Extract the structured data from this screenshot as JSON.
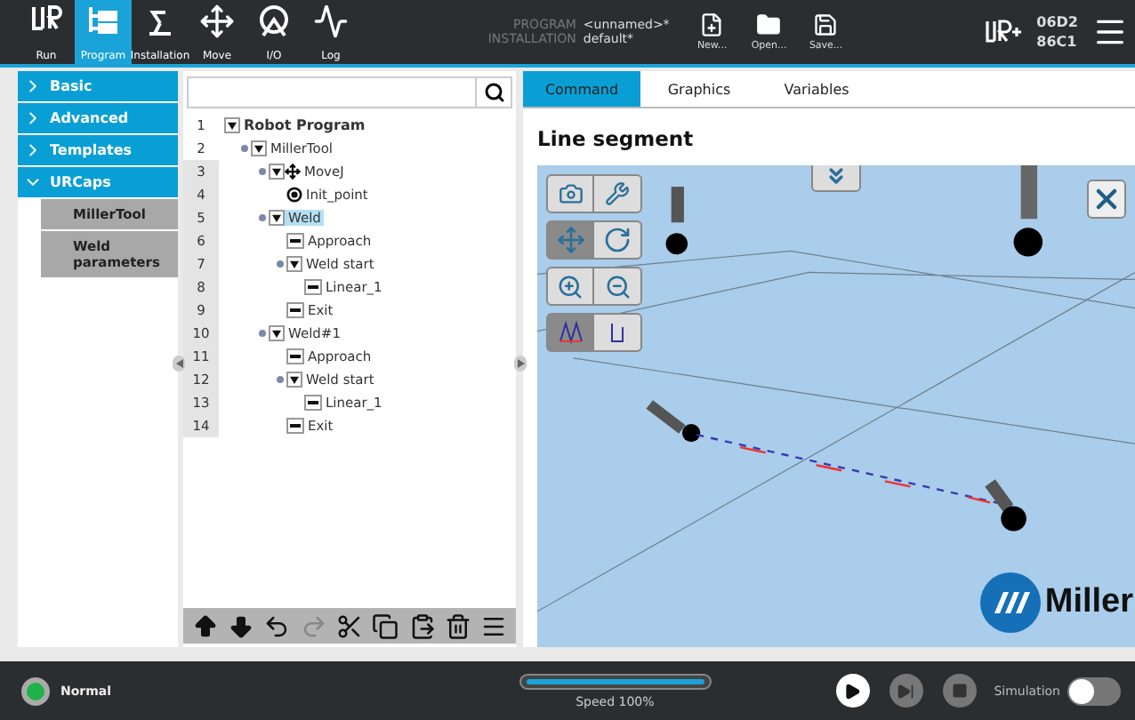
{
  "nav": [
    {
      "label": "Run",
      "kind": "run",
      "selected": false
    },
    {
      "label": "Program",
      "kind": "program",
      "selected": true
    },
    {
      "label": "Installation",
      "kind": "installation",
      "selected": false
    },
    {
      "label": "Move",
      "kind": "move",
      "selected": false
    },
    {
      "label": "I/O",
      "kind": "io",
      "selected": false
    },
    {
      "label": "Log",
      "kind": "log",
      "selected": false
    }
  ],
  "file_info": [
    {
      "key": "PROGRAM",
      "value": "<unnamed>*"
    },
    {
      "key": "INSTALLATION",
      "value": "default*"
    }
  ],
  "file_buttons": [
    {
      "label": "New...",
      "kind": "new"
    },
    {
      "label": "Open...",
      "kind": "open"
    },
    {
      "label": "Save...",
      "kind": "save"
    }
  ],
  "robot_id": [
    "06D2",
    "86C1"
  ],
  "categories": [
    {
      "label": "Basic",
      "expanded": false
    },
    {
      "label": "Advanced",
      "expanded": false
    },
    {
      "label": "Templates",
      "expanded": false
    },
    {
      "label": "URCaps",
      "expanded": true,
      "children": [
        {
          "label": "MillerTool"
        },
        {
          "label": "Weld parameters"
        }
      ]
    }
  ],
  "tree": [
    {
      "number": "1",
      "label": "Robot Program",
      "kind": "program",
      "expanded": true,
      "selected": false,
      "children": [
        {
          "number": "2",
          "label": "MillerTool",
          "kind": "folder",
          "expanded": true,
          "selected": false,
          "children": [
            {
              "number": "3",
              "label": "MoveJ",
              "kind": "move",
              "expanded": true,
              "selected": false,
              "children": [
                {
                  "number": "4",
                  "label": "Init_point",
                  "kind": "waypoint",
                  "selected": false
                }
              ]
            },
            {
              "number": "5",
              "label": "Weld",
              "kind": "folder",
              "expanded": true,
              "selected": true,
              "children": [
                {
                  "number": "6",
                  "label": "Approach",
                  "kind": "line",
                  "selected": false
                },
                {
                  "number": "7",
                  "label": "Weld start",
                  "kind": "folder",
                  "expanded": true,
                  "selected": false,
                  "children": [
                    {
                      "number": "8",
                      "label": "Linear_1",
                      "kind": "line",
                      "selected": false
                    }
                  ]
                },
                {
                  "number": "9",
                  "label": "Exit",
                  "kind": "line",
                  "selected": false
                }
              ]
            },
            {
              "number": "10",
              "label": "Weld#1",
              "kind": "folder",
              "expanded": true,
              "selected": false,
              "children": [
                {
                  "number": "11",
                  "label": "Approach",
                  "kind": "line",
                  "selected": false
                },
                {
                  "number": "12",
                  "label": "Weld start",
                  "kind": "folder",
                  "expanded": true,
                  "selected": false,
                  "children": [
                    {
                      "number": "13",
                      "label": "Linear_1",
                      "kind": "line",
                      "selected": false
                    }
                  ]
                },
                {
                  "number": "14",
                  "label": "Exit",
                  "kind": "line",
                  "selected": false
                }
              ]
            }
          ]
        }
      ]
    }
  ],
  "tools": [
    {
      "kind": "up",
      "disabled": false
    },
    {
      "kind": "down",
      "disabled": false
    },
    {
      "kind": "undo",
      "disabled": false
    },
    {
      "kind": "redo",
      "disabled": true
    },
    {
      "kind": "cut",
      "disabled": false
    },
    {
      "kind": "copy",
      "disabled": false
    },
    {
      "kind": "paste",
      "disabled": false
    },
    {
      "kind": "delete",
      "disabled": false
    },
    {
      "kind": "suppress",
      "disabled": false
    }
  ],
  "tabs": [
    {
      "label": "Command",
      "selected": true
    },
    {
      "label": "Graphics",
      "selected": false
    },
    {
      "label": "Variables",
      "selected": false
    }
  ],
  "command_title": "Line segment",
  "view_tools": [
    {
      "kind": "view-camera",
      "selected": false
    },
    {
      "kind": "view-tool",
      "selected": false
    },
    {
      "kind": "pan",
      "selected": true
    },
    {
      "kind": "rotate",
      "selected": false
    },
    {
      "kind": "zoom-in",
      "selected": false
    },
    {
      "kind": "zoom-out",
      "selected": false
    },
    {
      "kind": "path-full",
      "selected": true
    },
    {
      "kind": "path-part",
      "selected": false
    }
  ],
  "logo_text": "Miller",
  "status": {
    "label": "Normal",
    "color": "#1fb24a"
  },
  "speed": {
    "label": "Speed 100%",
    "level": 1.0
  },
  "player": [
    {
      "kind": "play",
      "disabled": false
    },
    {
      "kind": "step",
      "disabled": true
    },
    {
      "kind": "stop",
      "disabled": true
    }
  ],
  "simulation": {
    "label": "Simulation",
    "on": false
  }
}
